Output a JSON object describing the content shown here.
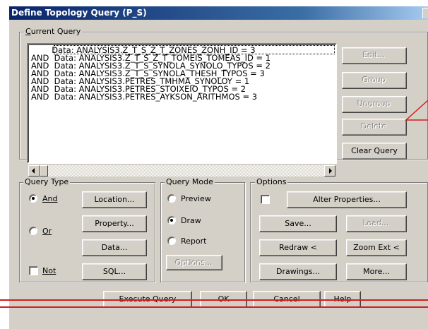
{
  "window": {
    "title": "Define Topology Query (P_S)"
  },
  "current_query": {
    "legend": "Current Query",
    "lines": [
      "        Data: ANALYSIS3.Z_T_S_Z_T_ZONES_ZONH_ID = 3",
      "AND  Data: ANALYSIS3.Z_T_S_Z_T_TOMEIS_TOMEAS_ID = 1",
      "AND  Data: ANALYSIS3.Z_T_S_SYNOLA_SYNOLO_TYPOS = 2",
      "AND  Data: ANALYSIS3.Z_T_S_SYNOLA_THESH_TYPOS = 3",
      "AND  Data: ANALYSIS3.PETRES_TMHMA_SYNOLOY = 1",
      "AND  Data: ANALYSIS3.PETRES_STOIXEIO_TYPOS = 2",
      "AND  Data: ANALYSIS3.PETRES_AYKSON_ARITHMOS = 3"
    ],
    "buttons": {
      "edit": "Edit...",
      "group": "Group",
      "ungroup": "Ungroup",
      "delete": "Delete",
      "clear": "Clear Query"
    }
  },
  "query_type": {
    "legend": "Query Type",
    "and_label": "And",
    "or_label": "Or",
    "not_label": "Not",
    "selected": "And",
    "not_checked": false,
    "buttons": {
      "location": "Location...",
      "property": "Property...",
      "data": "Data...",
      "sql": "SQL..."
    }
  },
  "query_mode": {
    "legend": "Query Mode",
    "preview": "Preview",
    "draw": "Draw",
    "report": "Report",
    "selected": "Draw",
    "options": "Options..."
  },
  "options": {
    "legend": "Options",
    "checked": false,
    "buttons": {
      "alter": "Alter Properties...",
      "save": "Save...",
      "load": "Load...",
      "redraw": "Redraw <",
      "zoom": "Zoom Ext <",
      "drawings": "Drawings...",
      "more": "More..."
    }
  },
  "footer": {
    "execute": "Execute Query",
    "ok": "OK",
    "cancel": "Cancel",
    "help": "Help"
  },
  "colors": {
    "annotation_line": "#d02020",
    "title_bar": "#0a246a",
    "face": "#d4d0c8"
  }
}
